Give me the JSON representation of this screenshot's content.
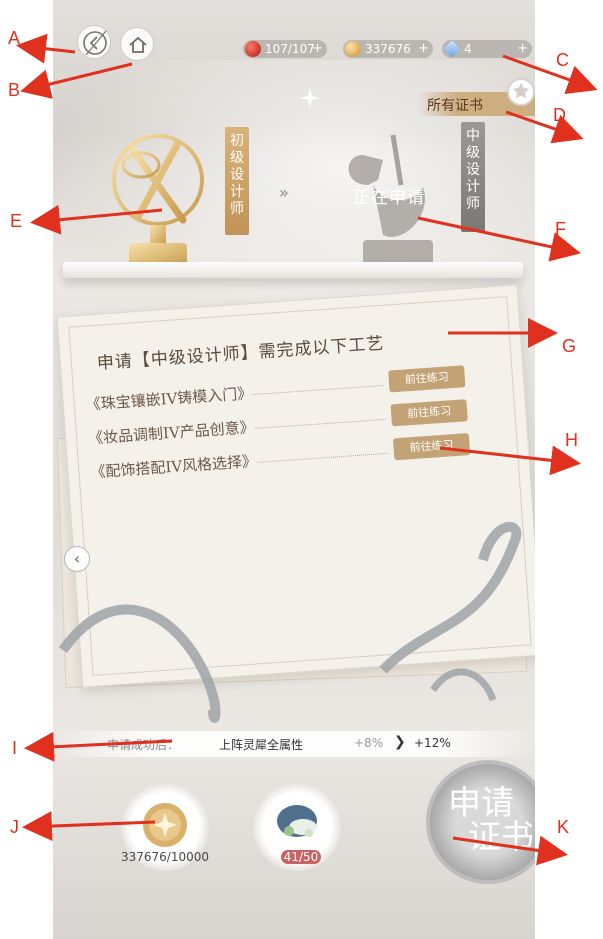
{
  "annotations": [
    "A",
    "B",
    "C",
    "D",
    "E",
    "F",
    "G",
    "H",
    "I",
    "J",
    "K"
  ],
  "resources": [
    {
      "icon": "apple-icon",
      "value": "107/107"
    },
    {
      "icon": "gold-coin-icon",
      "value": "337676"
    },
    {
      "icon": "diamond-icon",
      "value": "4"
    }
  ],
  "all_certificates": "所有证书",
  "current_rank": "初级设计师",
  "next_rank": "中级设计师",
  "rank_arrow": "»",
  "applying_status": "正在申请",
  "letter": {
    "title": "申请【中级设计师】需完成以下工艺",
    "tasks": [
      {
        "name": "《珠宝镶嵌IV铸模入门》",
        "button": "前往练习"
      },
      {
        "name": "《妆品调制IV产品创意》",
        "button": "前往练习"
      },
      {
        "name": "《配饰搭配IV风格选择》",
        "button": "前往练习"
      }
    ]
  },
  "bonus": {
    "label": "申请成功后：",
    "attribute": "上阵灵犀全属性",
    "from": "+8%",
    "arrow": "❯",
    "to": "+12%"
  },
  "costs": [
    {
      "icon": "gold-coin-icon",
      "value": "337676/10000"
    },
    {
      "icon": "hat-item-icon",
      "value": "41/50"
    }
  ],
  "apply_button": {
    "line1": "申请",
    "line2": "证书"
  },
  "colors": {
    "accent_gold": "#c3a276",
    "annotation_red": "#e0301e"
  }
}
